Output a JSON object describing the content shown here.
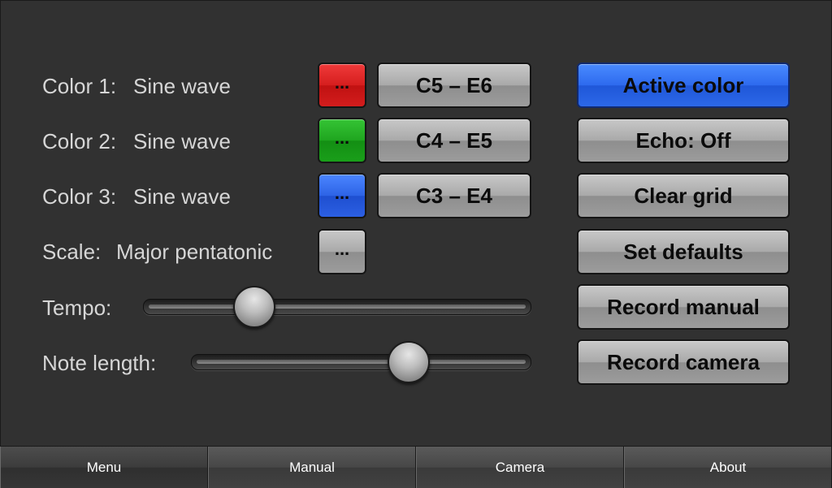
{
  "settings": {
    "colors": [
      {
        "label": "Color 1:",
        "wave": "Sine wave",
        "swatch_label": "...",
        "swatch_color": "#d61e1e",
        "range": "C5 – E6"
      },
      {
        "label": "Color 2:",
        "wave": "Sine wave",
        "swatch_label": "...",
        "swatch_color": "#1fa51f",
        "range": "C4 – E5"
      },
      {
        "label": "Color 3:",
        "wave": "Sine wave",
        "swatch_label": "...",
        "swatch_color": "#2d63e6",
        "range": "C3 – E4"
      }
    ],
    "scale": {
      "label": "Scale:",
      "value": "Major pentatonic",
      "button_label": "..."
    },
    "tempo": {
      "label": "Tempo:",
      "level": 0.26
    },
    "note_length": {
      "label": "Note length:",
      "level": 0.66
    }
  },
  "actions": {
    "active_color": "Active color",
    "echo": "Echo: Off",
    "clear_grid": "Clear grid",
    "set_defaults": "Set defaults",
    "record_manual": "Record manual",
    "record_camera": "Record camera"
  },
  "accent_color": "#2d6aee",
  "tabs": [
    {
      "label": "Menu",
      "active": true
    },
    {
      "label": "Manual",
      "active": false
    },
    {
      "label": "Camera",
      "active": false
    },
    {
      "label": "About",
      "active": false
    }
  ]
}
